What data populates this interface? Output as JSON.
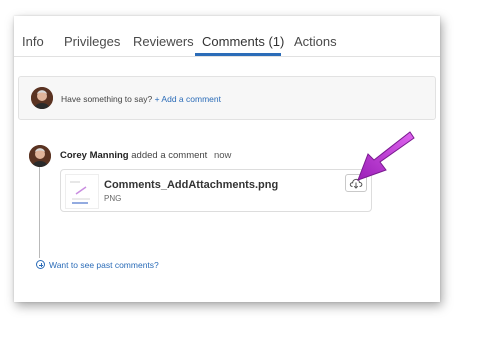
{
  "tabs": [
    {
      "label": "Info"
    },
    {
      "label": "Privileges"
    },
    {
      "label": "Reviewers"
    },
    {
      "label": "Comments (1)",
      "active": true
    },
    {
      "label": "Actions"
    }
  ],
  "add_comment": {
    "prompt": "Have something to say?",
    "link": "+ Add a comment"
  },
  "comment": {
    "author": "Corey Manning",
    "action": "added a comment",
    "time": "now",
    "attachment": {
      "file_name": "Comments_AddAttachments.png",
      "file_type": "PNG",
      "download_icon": "cloud-download-icon"
    }
  },
  "past_comments_link": "Want to see past comments?",
  "colors": {
    "accent": "#2b6cb8",
    "arrow": "#c02fd6"
  }
}
